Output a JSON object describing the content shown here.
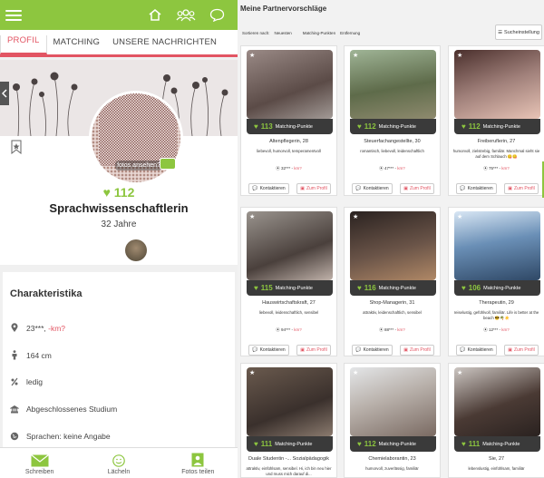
{
  "left": {
    "tabs": [
      "PROFIL",
      "MATCHING",
      "UNSERE NACHRICHTEN"
    ],
    "profile": {
      "photo_overlay": "fotos ansehen?",
      "matching_points": "112",
      "title": "Sprachwissenschaftlerin",
      "age": "32 Jahre"
    },
    "characteristics": {
      "heading": "Charakteristika",
      "location_prefix": "23***,",
      "location_km": "-km?",
      "height": "164 cm",
      "status": "ledig",
      "education": "Abgeschlossenes Studium",
      "languages": "Sprachen: keine Angabe"
    },
    "bottom_nav": [
      "Schreiben",
      "Lächeln",
      "Fotos teilen"
    ]
  },
  "right": {
    "title": "Meine Partnervorschläge",
    "sort_options": [
      "Sortieren nach:",
      "Neuesten",
      "Matching-Punkten",
      "Entfernung"
    ],
    "search_settings": "Sucheinstellung",
    "matching_label": "Matching-Punkte",
    "contact_label": "Kontaktieren",
    "profile_label": "Zum Profil",
    "cards": [
      {
        "points": "113",
        "name": "Altenpflegerin, 28",
        "tags": "liebevoll, humorvoll, temperamentvoll",
        "loc": "32*** - km?"
      },
      {
        "points": "112",
        "name": "Steuerfachangestellte, 30",
        "tags": "romantisch, liebevoll, leidenschaftlich",
        "loc": "47*** - km?"
      },
      {
        "points": "112",
        "name": "Freiberuflerin, 27",
        "tags": "humorvoll, zielstrebig, familiär. Manchmal sieht sie auf dem Schlauch 😋😋",
        "loc": "75*** - km?"
      },
      {
        "points": "115",
        "name": "Hauswirtschaftskraft, 27",
        "tags": "liebevoll, leidenschaftlich, sensibel",
        "loc": "94*** - km?"
      },
      {
        "points": "116",
        "name": "Shop-Managerin, 31",
        "tags": "attraktiv, leidenschaftlich, sensibel",
        "loc": "88*** - km?"
      },
      {
        "points": "106",
        "name": "Therapeutin, 29",
        "tags": "reiselustig, gefühlvoll, familiär. Life is better at the beach 😎🌴☀️",
        "loc": "12*** - km?"
      },
      {
        "points": "111",
        "name": "Duale Studentin -... Sozialpädagogik",
        "tags": "attraktiv, einfühlsam, sensibel. Hi, ich bin neu hier und muss mich darauf di...",
        "loc": ""
      },
      {
        "points": "112",
        "name": "Chemielaborantin, 23",
        "tags": "humorvoll, zuverlässig, familiär",
        "loc": ""
      },
      {
        "points": "111",
        "name": "Sie, 27",
        "tags": "lebenslustig, einfühlsam, familiär",
        "loc": ""
      }
    ]
  }
}
